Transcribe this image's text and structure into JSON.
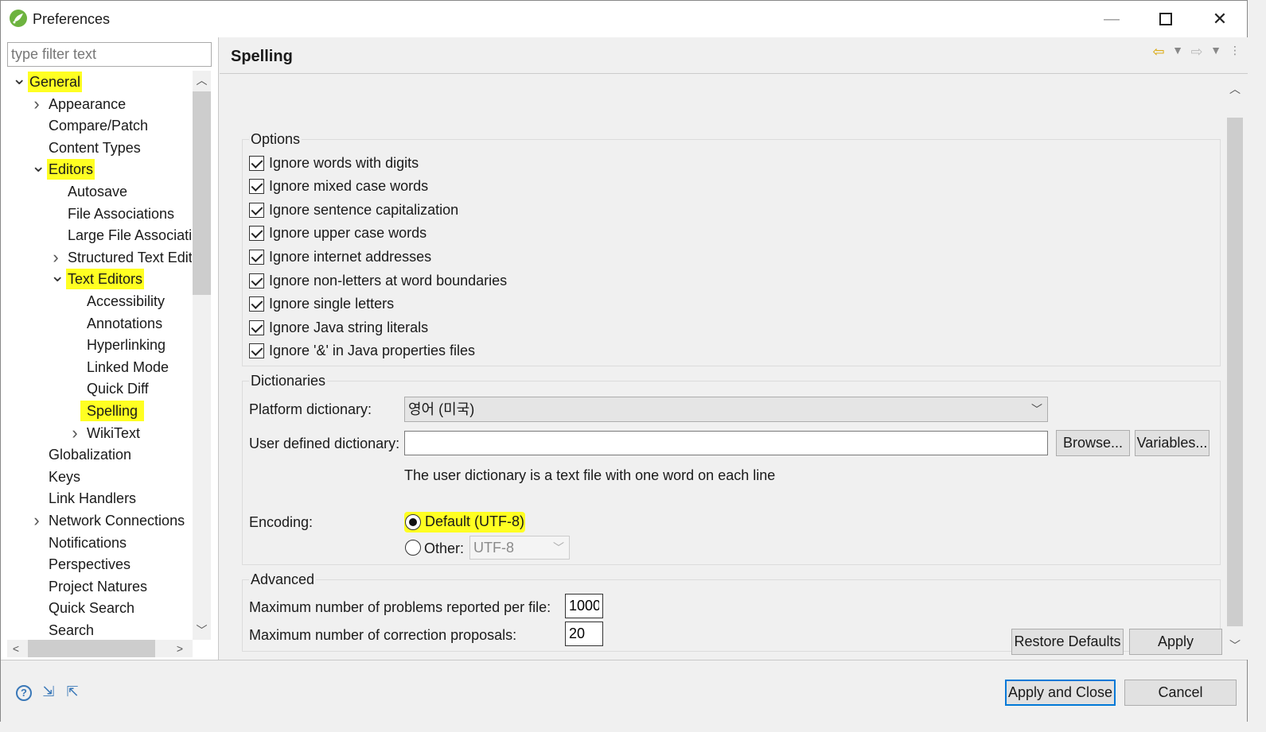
{
  "window": {
    "title": "Preferences"
  },
  "filter": {
    "placeholder": "type filter text"
  },
  "tree": {
    "items": [
      {
        "label": "General",
        "level": 0,
        "twisty": "open",
        "highlight": true
      },
      {
        "label": "Appearance",
        "level": 1,
        "twisty": "closed",
        "highlight": false
      },
      {
        "label": "Compare/Patch",
        "level": 1,
        "twisty": "",
        "highlight": false
      },
      {
        "label": "Content Types",
        "level": 1,
        "twisty": "",
        "highlight": false
      },
      {
        "label": "Editors",
        "level": 1,
        "twisty": "open",
        "highlight": true
      },
      {
        "label": "Autosave",
        "level": 2,
        "twisty": "",
        "highlight": false
      },
      {
        "label": "File Associations",
        "level": 2,
        "twisty": "",
        "highlight": false
      },
      {
        "label": "Large File Associations",
        "level": 2,
        "twisty": "",
        "highlight": false
      },
      {
        "label": "Structured Text Editors",
        "level": 2,
        "twisty": "closed",
        "highlight": false
      },
      {
        "label": "Text Editors",
        "level": 2,
        "twisty": "open",
        "highlight": true
      },
      {
        "label": "Accessibility",
        "level": 3,
        "twisty": "",
        "highlight": false
      },
      {
        "label": "Annotations",
        "level": 3,
        "twisty": "",
        "highlight": false
      },
      {
        "label": "Hyperlinking",
        "level": 3,
        "twisty": "",
        "highlight": false
      },
      {
        "label": "Linked Mode",
        "level": 3,
        "twisty": "",
        "highlight": false
      },
      {
        "label": "Quick Diff",
        "level": 3,
        "twisty": "",
        "highlight": false
      },
      {
        "label": "Spelling",
        "level": 3,
        "twisty": "",
        "highlight": true
      },
      {
        "label": "WikiText",
        "level": 3,
        "twisty": "closed",
        "highlight": false
      },
      {
        "label": "Globalization",
        "level": 1,
        "twisty": "",
        "highlight": false
      },
      {
        "label": "Keys",
        "level": 1,
        "twisty": "",
        "highlight": false
      },
      {
        "label": "Link Handlers",
        "level": 1,
        "twisty": "",
        "highlight": false
      },
      {
        "label": "Network Connections",
        "level": 1,
        "twisty": "closed",
        "highlight": false
      },
      {
        "label": "Notifications",
        "level": 1,
        "twisty": "",
        "highlight": false
      },
      {
        "label": "Perspectives",
        "level": 1,
        "twisty": "",
        "highlight": false
      },
      {
        "label": "Project Natures",
        "level": 1,
        "twisty": "",
        "highlight": false
      },
      {
        "label": "Quick Search",
        "level": 1,
        "twisty": "",
        "highlight": false
      },
      {
        "label": "Search",
        "level": 1,
        "twisty": "",
        "highlight": false
      }
    ]
  },
  "page": {
    "title": "Spelling",
    "options": {
      "title": "Options",
      "checkboxes": [
        {
          "label": "Ignore words with digits",
          "checked": true
        },
        {
          "label": "Ignore mixed case words",
          "checked": true
        },
        {
          "label": "Ignore sentence capitalization",
          "checked": true
        },
        {
          "label": "Ignore upper case words",
          "checked": true
        },
        {
          "label": "Ignore internet addresses",
          "checked": true
        },
        {
          "label": "Ignore non-letters at word boundaries",
          "checked": true
        },
        {
          "label": "Ignore single letters",
          "checked": true
        },
        {
          "label": "Ignore Java string literals",
          "checked": true
        },
        {
          "label": "Ignore '&' in Java properties files",
          "checked": true
        }
      ]
    },
    "dictionaries": {
      "title": "Dictionaries",
      "platform_label": "Platform dictionary:",
      "platform_value": "영어 (미국)",
      "user_label": "User defined dictionary:",
      "user_value": "",
      "browse_label": "Browse...",
      "variables_label": "Variables...",
      "hint": "The user dictionary is a text file with one word on each line",
      "encoding_label": "Encoding:",
      "default_label": "Default (UTF-8)",
      "other_label": "Other:",
      "other_value": "UTF-8",
      "selected": "default"
    },
    "advanced": {
      "title": "Advanced",
      "max_problems_label": "Maximum number of problems reported per file:",
      "max_problems_value": "1000",
      "max_proposals_label": "Maximum number of correction proposals:",
      "max_proposals_value": "20"
    },
    "restore_defaults_label": "Restore Defaults",
    "apply_label": "Apply"
  },
  "footer": {
    "apply_close_label": "Apply and Close",
    "cancel_label": "Cancel"
  },
  "colors": {
    "highlight": "#ffff22",
    "default_button_border": "#0078d7",
    "nav_back": "#d9a400"
  }
}
